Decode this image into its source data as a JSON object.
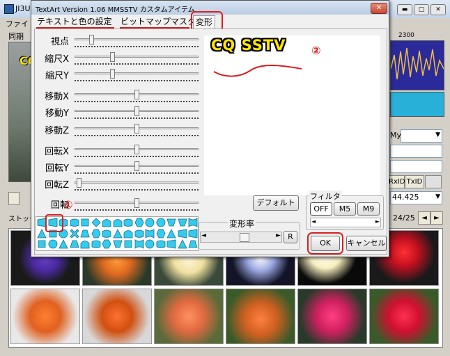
{
  "main_window": {
    "title": "JI3U",
    "menu": [
      "ファイ"
    ],
    "sync_tab": "同期",
    "stock_label": "ストック画",
    "freq_label": "2300",
    "my_label": "My",
    "rxid_label": "RxID",
    "txid_label": "TxID",
    "freq_value": "44.425",
    "page_counter": "24/25",
    "nav_prev": "◄",
    "nav_next": "►",
    "overlay_cq": "CQ"
  },
  "dialog": {
    "title": "TextArt Version 1.06  MMSSTV カスタムアイテム",
    "close_label": "✕",
    "tabs": [
      "テキストと色の設定",
      "ビットマップマスク",
      "変形"
    ],
    "active_tab": "変形",
    "sliders": [
      {
        "label": "視点",
        "value": 0.12
      },
      {
        "label": "縮尺X",
        "value": 0.3
      },
      {
        "label": "縮尺Y",
        "value": 0.3
      },
      {
        "label": "移動X",
        "value": 0.5
      },
      {
        "label": "移動Y",
        "value": 0.5
      },
      {
        "label": "移動Z",
        "value": 0.5
      },
      {
        "label": "回転X",
        "value": 0.5
      },
      {
        "label": "回転Y",
        "value": 0.5
      },
      {
        "label": "回転Z",
        "value": 0.02
      },
      {
        "label": "回転",
        "value": 0.5
      }
    ],
    "preview_text": "CQ SSTV",
    "annotation_1": "①",
    "annotation_2": "②",
    "default_button": "デフォルト",
    "filter_label": "フィルタ",
    "filter_options": [
      "OFF",
      "M5",
      "M9"
    ],
    "filter_selected": "OFF",
    "transform_rate_label": "変形率",
    "rate_value": 0.5,
    "r_button": "R",
    "ok_button": "OK",
    "cancel_button": "キャンセル",
    "shape_icons_count": 30
  },
  "colors": {
    "annotation_red": "#d62020",
    "shape_cyan": "#33ccee",
    "cq_yellow": "#ffe400"
  }
}
